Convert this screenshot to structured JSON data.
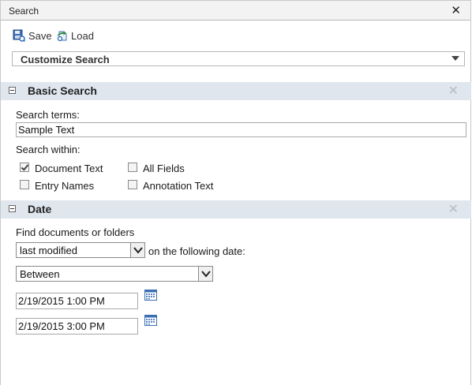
{
  "window": {
    "title": "Search"
  },
  "toolbar": {
    "save_label": "Save",
    "load_label": "Load"
  },
  "customize": {
    "label": "Customize Search"
  },
  "basic": {
    "title": "Basic Search",
    "terms_label": "Search terms:",
    "terms_value": "Sample Text",
    "within_label": "Search within:",
    "options": [
      {
        "label": "Document Text",
        "checked": true
      },
      {
        "label": "All Fields",
        "checked": false
      },
      {
        "label": "Entry Names",
        "checked": false
      },
      {
        "label": "Annotation Text",
        "checked": false
      }
    ]
  },
  "date": {
    "title": "Date",
    "find_label": "Find documents or folders",
    "mode_value": "last modified",
    "following_label": "on the following date:",
    "range_value": "Between",
    "start_value": "2/19/2015 1:00 PM",
    "end_value": "2/19/2015 3:00 PM"
  }
}
